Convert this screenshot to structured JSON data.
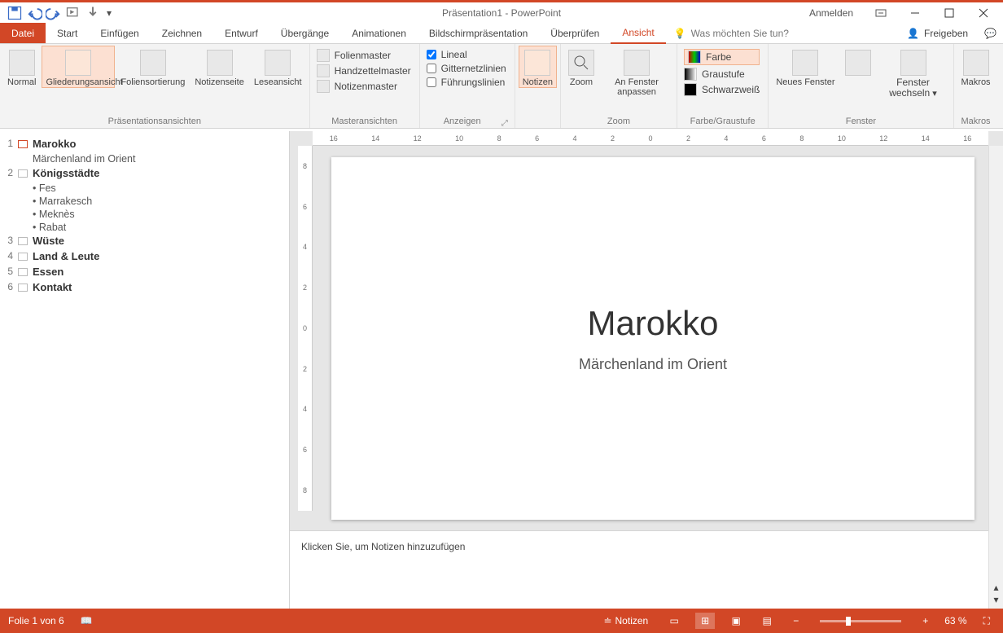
{
  "titlebar": {
    "title": "Präsentation1 - PowerPoint",
    "login": "Anmelden"
  },
  "tabs": {
    "file": "Datei",
    "start": "Start",
    "insert": "Einfügen",
    "draw": "Zeichnen",
    "design": "Entwurf",
    "trans": "Übergänge",
    "anim": "Animationen",
    "show": "Bildschirmpräsentation",
    "review": "Überprüfen",
    "view": "Ansicht",
    "tellme": "Was möchten Sie tun?",
    "share": "Freigeben"
  },
  "ribbon": {
    "views": {
      "normal": "Normal",
      "outline": "Gliederungsansicht",
      "sorter": "Foliensortierung",
      "notes": "Notizenseite",
      "reading": "Leseansicht",
      "group": "Präsentationsansichten"
    },
    "master": {
      "slide": "Folienmaster",
      "handout": "Handzettelmaster",
      "notes": "Notizenmaster",
      "group": "Masteransichten"
    },
    "show": {
      "ruler": "Lineal",
      "grid": "Gitternetzlinien",
      "guides": "Führungslinien",
      "group": "Anzeigen"
    },
    "notesBtn": "Notizen",
    "zoom": {
      "zoom": "Zoom",
      "fit": "An Fenster anpassen",
      "group": "Zoom"
    },
    "color": {
      "color": "Farbe",
      "gray": "Graustufe",
      "bw": "Schwarzweiß",
      "group": "Farbe/Graustufe"
    },
    "window": {
      "new": "Neues Fenster",
      "switch": "Fenster wechseln",
      "group": "Fenster"
    },
    "macros": {
      "label": "Makros",
      "group": "Makros"
    }
  },
  "outline": [
    {
      "n": "1",
      "title": "Marokko",
      "sel": true,
      "sub": "Märchenland im Orient"
    },
    {
      "n": "2",
      "title": "Königsstädte",
      "bullets": [
        "Fes",
        "Marrakesch",
        "Meknès",
        "Rabat"
      ]
    },
    {
      "n": "3",
      "title": "Wüste"
    },
    {
      "n": "4",
      "title": "Land & Leute"
    },
    {
      "n": "5",
      "title": "Essen"
    },
    {
      "n": "6",
      "title": "Kontakt"
    }
  ],
  "ruler": {
    "h": [
      "16",
      "14",
      "12",
      "10",
      "8",
      "6",
      "4",
      "2",
      "0",
      "2",
      "4",
      "6",
      "8",
      "10",
      "12",
      "14",
      "16"
    ],
    "v": [
      "8",
      "6",
      "4",
      "2",
      "0",
      "2",
      "4",
      "6",
      "8"
    ]
  },
  "slide": {
    "title": "Marokko",
    "subtitle": "Märchenland im Orient"
  },
  "notes_placeholder": "Klicken Sie, um Notizen hinzuzufügen",
  "status": {
    "slide": "Folie 1 von 6",
    "notes": "Notizen",
    "zoom": "63 %"
  }
}
